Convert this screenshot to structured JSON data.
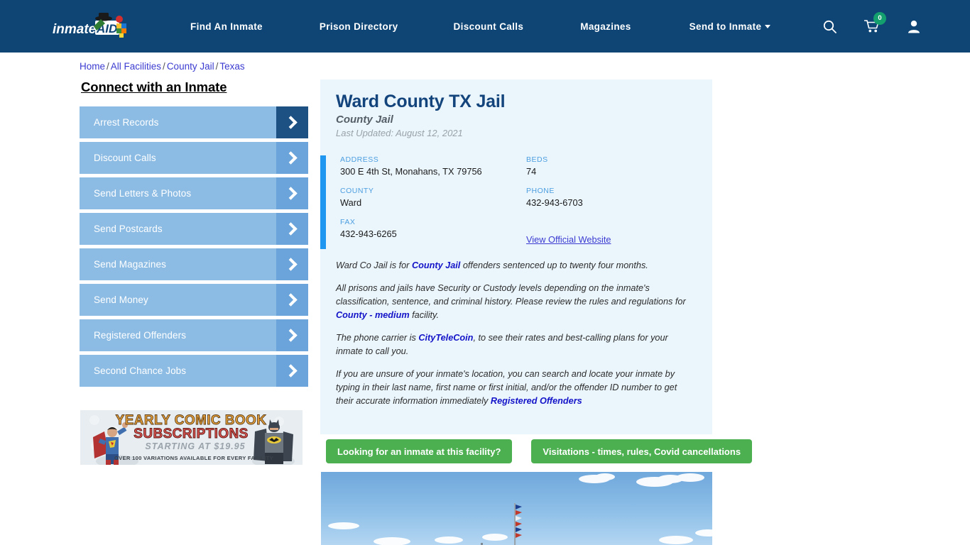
{
  "header": {
    "logo_text": "inmateAID",
    "logo_alt": "inmate-aid-logo",
    "nav": [
      {
        "label": "Find An Inmate"
      },
      {
        "label": "Prison Directory"
      },
      {
        "label": "Discount Calls"
      },
      {
        "label": "Magazines"
      },
      {
        "label": "Send to Inmate"
      }
    ],
    "icons": {
      "search": "search-icon",
      "cart": "shopping-cart-icon",
      "cart_count": "0",
      "account": "user-account-icon"
    },
    "bg_color": "#0e4575",
    "badge_color": "#14a06e"
  },
  "breadcrumb": {
    "items": [
      "Home",
      "All Facilities",
      "County Jail",
      "Texas"
    ],
    "separator": "/"
  },
  "sidebar": {
    "title": "Connect with an Inmate",
    "items": [
      {
        "label": "Arrest Records",
        "active": true
      },
      {
        "label": "Discount Calls",
        "active": false
      },
      {
        "label": "Send Letters & Photos",
        "active": false
      },
      {
        "label": "Send Postcards",
        "active": false
      },
      {
        "label": "Send Magazines",
        "active": false
      },
      {
        "label": "Send Money",
        "active": false
      },
      {
        "label": "Registered Offenders",
        "active": false
      },
      {
        "label": "Second Chance Jobs",
        "active": false
      }
    ],
    "ad": {
      "line1": "YEARLY COMIC BOOK",
      "line2": "SUBSCRIPTIONS",
      "line3": "STARTING AT $19.95",
      "line4": "OVER 100 VARIATIONS AVAILABLE FOR EVERY FACILITY"
    }
  },
  "facility": {
    "title": "Ward County TX Jail",
    "subtitle": "County Jail",
    "last_updated": "Last Updated: August 12, 2021",
    "fields": {
      "address_label": "ADDRESS",
      "address_value": "300 E 4th St, Monahans, TX 79756",
      "county_label": "COUNTY",
      "county_value": "Ward",
      "fax_label": "FAX",
      "fax_value": "432-943-6265",
      "beds_label": "BEDS",
      "beds_value": "74",
      "phone_label": "PHONE",
      "phone_value": "432-943-6703",
      "website_link": "View Official Website"
    },
    "description": {
      "p1_a": "Ward Co Jail is for ",
      "p1_link": "County Jail",
      "p1_b": " offenders sentenced up to twenty four months.",
      "p2_a": "All prisons and jails have Security or Custody levels depending on the inmate's classification, sentence, and criminal history. Please review the rules and regulations for ",
      "p2_link": "County - medium",
      "p2_b": " facility.",
      "p3_a": "The phone carrier is ",
      "p3_link": "CityTeleCoin",
      "p3_b": ", to see their rates and best-calling plans for your inmate to call you.",
      "p4_a": "If you are unsure of your inmate's location, you can search and locate your inmate by typing in their last name, first name or first initial, and/or the offender ID number to get their accurate information immediately ",
      "p4_link": "Registered Offenders"
    }
  },
  "cta": {
    "inmate_search_label": "Looking for an inmate at this facility?",
    "visitation_label": "Visitations - times, rules, Covid cancellations",
    "color": "#4caf50"
  },
  "photo": {
    "alt": "facility-photo-sky-with-flagpole"
  }
}
